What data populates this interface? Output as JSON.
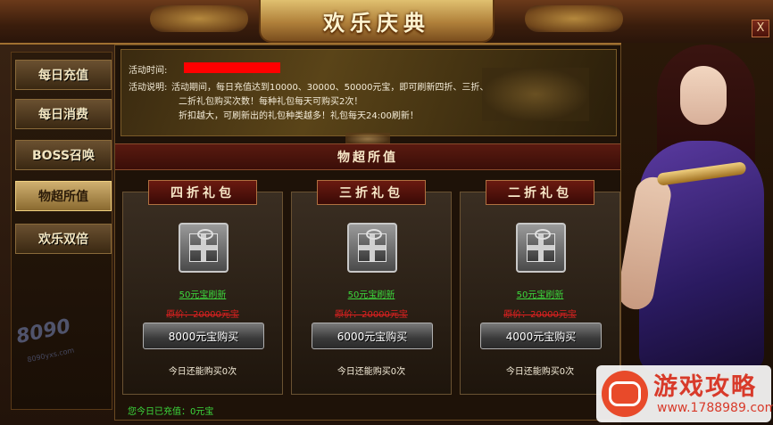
{
  "window": {
    "title": "欢乐庆典",
    "close_glyph": "X"
  },
  "sidebar": {
    "items": [
      {
        "label": "每日充值",
        "active": false
      },
      {
        "label": "每日消费",
        "active": false
      },
      {
        "label": "BOSS召唤",
        "active": false
      },
      {
        "label": "物超所值",
        "active": true
      },
      {
        "label": "欢乐双倍",
        "active": false
      }
    ],
    "logo_text": "8090",
    "logo_sub": "8090yxs.com"
  },
  "activity": {
    "time_label": "活动时间:",
    "desc_label": "活动说明:",
    "desc_line1": "活动期间，每日充值达到10000、30000、50000元宝，即可刷新四折、三折、",
    "desc_line2": "二折礼包购买次数！每种礼包每天可购买2次！",
    "desc_line3": "折扣越大，可刷新出的礼包种类越多！礼包每天24:00刷新！"
  },
  "section": {
    "title": "物超所值"
  },
  "packages": [
    {
      "title": "四折礼包",
      "refresh": "50元宝刷新",
      "orig_price": "原价：20000元宝",
      "buy_label": "8000元宝购买",
      "remain": "今日还能购买0次"
    },
    {
      "title": "三折礼包",
      "refresh": "50元宝刷新",
      "orig_price": "原价：20000元宝",
      "buy_label": "6000元宝购买",
      "remain": "今日还能购买0次"
    },
    {
      "title": "二折礼包",
      "refresh": "50元宝刷新",
      "orig_price": "原价：20000元宝",
      "buy_label": "4000元宝购买",
      "remain": "今日还能购买0次"
    }
  ],
  "footer": {
    "today_charge": "您今日已充值：0元宝"
  },
  "watermark": {
    "title": "游戏攻略",
    "url": "www.1788989.com"
  },
  "colors": {
    "accent_green": "#3cd93c",
    "price_red": "#e02020",
    "title_gold": "#fff4d0"
  }
}
